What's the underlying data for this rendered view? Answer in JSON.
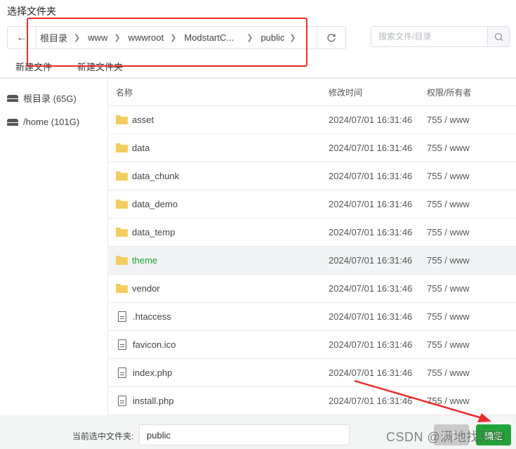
{
  "dialog": {
    "title": "选择文件夹"
  },
  "pathbar": {
    "back_icon": "arrow-left-icon",
    "crumbs": [
      {
        "label": "根目录"
      },
      {
        "label": "www"
      },
      {
        "label": "wwwroot"
      },
      {
        "label": "ModstartC..."
      },
      {
        "label": "public"
      }
    ],
    "refresh_icon": "refresh-icon"
  },
  "search": {
    "placeholder": "搜索文件/目录",
    "value": "",
    "icon": "search-icon"
  },
  "actions": {
    "new_file": "新建文件",
    "new_folder": "新建文件夹"
  },
  "sidebar": {
    "disks": [
      {
        "label": "根目录 (65G)",
        "icon": "disk-icon"
      },
      {
        "label": "/home (101G)",
        "icon": "disk-icon"
      }
    ]
  },
  "table": {
    "headers": {
      "name": "名称",
      "time": "修改时间",
      "perm": "权限/所有者"
    },
    "rows": [
      {
        "type": "folder",
        "name": "asset",
        "time": "2024/07/01 16:31:46",
        "perm": "755 / www"
      },
      {
        "type": "folder",
        "name": "data",
        "time": "2024/07/01 16:31:46",
        "perm": "755 / www"
      },
      {
        "type": "folder",
        "name": "data_chunk",
        "time": "2024/07/01 16:31:46",
        "perm": "755 / www"
      },
      {
        "type": "folder",
        "name": "data_demo",
        "time": "2024/07/01 16:31:46",
        "perm": "755 / www"
      },
      {
        "type": "folder",
        "name": "data_temp",
        "time": "2024/07/01 16:31:46",
        "perm": "755 / www"
      },
      {
        "type": "folder",
        "name": "theme",
        "time": "2024/07/01 16:31:46",
        "perm": "755 / www",
        "active": true
      },
      {
        "type": "folder",
        "name": "vendor",
        "time": "2024/07/01 16:31:46",
        "perm": "755 / www"
      },
      {
        "type": "file",
        "name": ".htaccess",
        "time": "2024/07/01 16:31:46",
        "perm": "755 / www"
      },
      {
        "type": "file",
        "name": "favicon.ico",
        "time": "2024/07/01 16:31:46",
        "perm": "755 / www"
      },
      {
        "type": "file",
        "name": "index.php",
        "time": "2024/07/01 16:31:46",
        "perm": "755 / www"
      },
      {
        "type": "file",
        "name": "install.php",
        "time": "2024/07/01 16:31:46",
        "perm": "755 / www"
      }
    ]
  },
  "footer": {
    "label": "当前选中文件夹:",
    "value": "public",
    "cancel_label": "取消",
    "confirm_label": "确定"
  },
  "annotations": {
    "highlight_color": "#ec2b2b",
    "watermark": "CSDN @满地找牙哟"
  },
  "colors": {
    "accent": "#21a33a",
    "folder": "#f4cd62"
  }
}
